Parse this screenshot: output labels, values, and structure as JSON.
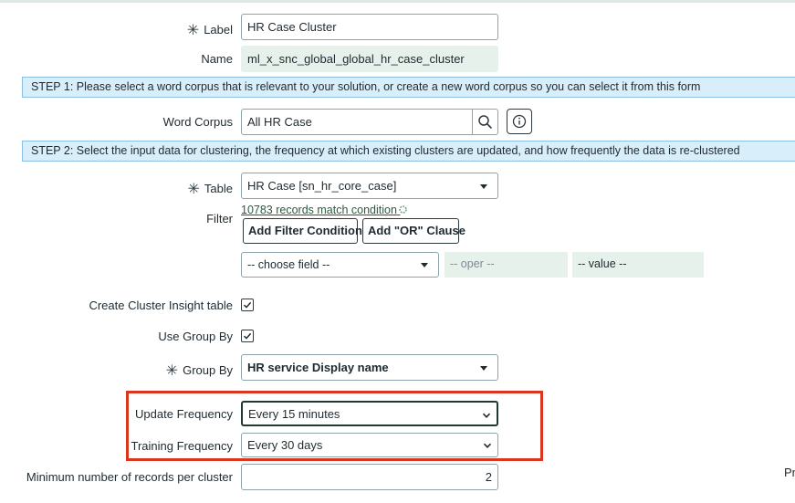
{
  "fields": {
    "label": {
      "label": "Label",
      "value": "HR Case Cluster"
    },
    "name": {
      "label": "Name",
      "value": "ml_x_snc_global_global_hr_case_cluster"
    },
    "step1": "STEP 1: Please select a word corpus that is relevant to your solution, or create a new word corpus so you can select it from this form",
    "word_corpus": {
      "label": "Word Corpus",
      "value": "All HR Case"
    },
    "step2": "STEP 2: Select the input data for clustering, the frequency at which existing clusters are updated, and how frequently the data is re-clustered",
    "table": {
      "label": "Table",
      "value": "HR Case [sn_hr_core_case]"
    },
    "filter": {
      "label": "Filter",
      "records_link": "10783 records match condition",
      "add_condition": "Add Filter Condition",
      "add_or": "Add \"OR\" Clause",
      "choose_field": "-- choose field --",
      "oper": "-- oper --",
      "value": "-- value --"
    },
    "cluster_insight": {
      "label": "Create Cluster Insight table",
      "checked": true
    },
    "use_group_by": {
      "label": "Use Group By",
      "checked": true
    },
    "group_by": {
      "label": "Group By",
      "value": "HR service Display name"
    },
    "update_frequency": {
      "label": "Update Frequency",
      "value": "Every 15 minutes"
    },
    "training_frequency": {
      "label": "Training Frequency",
      "value": "Every 30 days"
    },
    "min_records": {
      "label": "Minimum number of records per cluster",
      "value": "2"
    },
    "right_cutoff": "Pr"
  },
  "colors": {
    "highlight": "#d9351f",
    "step_bg": "#d9eefb",
    "readonly_bg": "#e5f1ea"
  },
  "icons": [
    "required-asterisk-icon",
    "search-icon",
    "info-icon",
    "caret-down-icon",
    "chevron-down-icon",
    "checkmark-icon"
  ]
}
